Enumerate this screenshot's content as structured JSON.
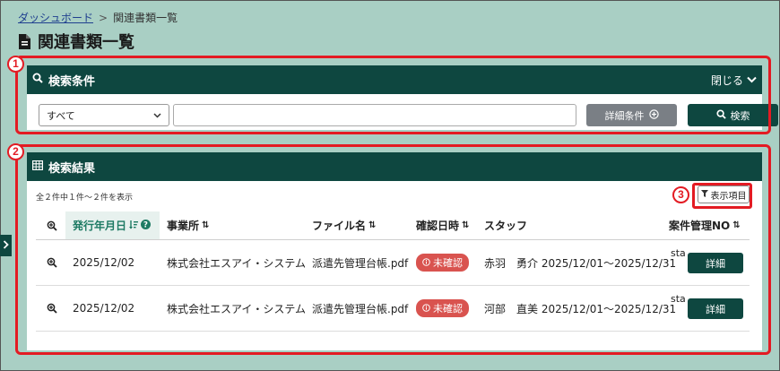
{
  "breadcrumb": {
    "home": "ダッシュボード",
    "separator": ">",
    "current": "関連書類一覧"
  },
  "page": {
    "title": "関連書類一覧"
  },
  "callouts": {
    "c1": "1",
    "c2": "2",
    "c3": "3"
  },
  "search": {
    "header": "検索条件",
    "toggle_label": "閉じる",
    "select_value": "すべて",
    "text_value": "",
    "detail_button": "詳細条件",
    "search_button": "検索"
  },
  "results": {
    "header": "検索結果",
    "count_text": "全２件中１件～２件を表示",
    "columns_button": "表示項目",
    "columns": {
      "issue_date": "発行年月日",
      "office": "事業所",
      "filename": "ファイル名",
      "confirmed_at": "確認日時",
      "staff": "スタッフ",
      "case_no": "案件管理NO"
    },
    "rows": [
      {
        "date": "2025/12/02",
        "office": "株式会社エスアイ・システム",
        "filename": "派遣先管理台帳.pdf",
        "status": "未確認",
        "staff": "赤羽　勇介 2025/12/01～2025/12/31",
        "case_no": "sta",
        "action": "詳細"
      },
      {
        "date": "2025/12/02",
        "office": "株式会社エスアイ・システム",
        "filename": "派遣先管理台帳.pdf",
        "status": "未確認",
        "staff": "河部　直美 2025/12/01～2025/12/31",
        "case_no": "sta",
        "action": "詳細"
      }
    ]
  },
  "colors": {
    "primary": "#0e4740",
    "background": "#a9cfc4",
    "callout": "#e31b23",
    "badge": "#d9534f"
  }
}
